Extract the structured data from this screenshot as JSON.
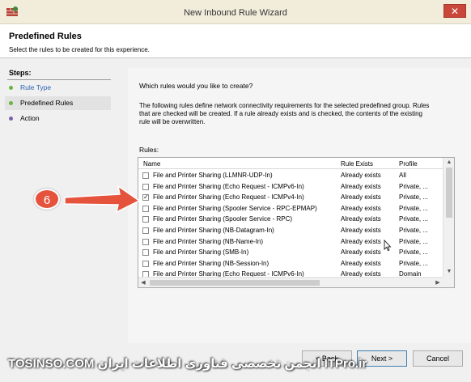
{
  "window": {
    "title": "New Inbound Rule Wizard",
    "close_glyph": "✕",
    "icon": "firewall-icon"
  },
  "header": {
    "title": "Predefined Rules",
    "subtitle": "Select the rules to be created for this experience."
  },
  "steps": {
    "title": "Steps:",
    "items": [
      {
        "label": "Rule Type",
        "color": "#2f64b5"
      },
      {
        "label": "Predefined Rules",
        "color": "#222222"
      },
      {
        "label": "Action",
        "color": "#222222"
      }
    ]
  },
  "content": {
    "question": "Which rules would you like to create?",
    "description": "The following rules define network connectivity requirements for the selected predefined group. Rules that are checked will be created. If a rule already exists and is checked, the contents of the existing rule will be overwritten.",
    "rules_label": "Rules:"
  },
  "table": {
    "columns": [
      "Name",
      "Rule Exists",
      "Profile"
    ],
    "rows": [
      {
        "name": "File and Printer Sharing (LLMNR-UDP-In)",
        "exists": "Already exists",
        "profile": "All",
        "checked": false
      },
      {
        "name": "File and Printer Sharing (Echo Request - ICMPv6-In)",
        "exists": "Already exists",
        "profile": "Private, ...",
        "checked": false
      },
      {
        "name": "File and Printer Sharing (Echo Request - ICMPv4-In)",
        "exists": "Already exists",
        "profile": "Private, ...",
        "checked": true
      },
      {
        "name": "File and Printer Sharing (Spooler Service - RPC-EPMAP)",
        "exists": "Already exists",
        "profile": "Private, ...",
        "checked": false
      },
      {
        "name": "File and Printer Sharing (Spooler Service - RPC)",
        "exists": "Already exists",
        "profile": "Private, ...",
        "checked": false
      },
      {
        "name": "File and Printer Sharing (NB-Datagram-In)",
        "exists": "Already exists",
        "profile": "Private, ...",
        "checked": false
      },
      {
        "name": "File and Printer Sharing (NB-Name-In)",
        "exists": "Already exists",
        "profile": "Private, ...",
        "checked": false
      },
      {
        "name": "File and Printer Sharing (SMB-In)",
        "exists": "Already exists",
        "profile": "Private, ...",
        "checked": false
      },
      {
        "name": "File and Printer Sharing (NB-Session-In)",
        "exists": "Already exists",
        "profile": "Private, ...",
        "checked": false
      },
      {
        "name": "File and Printer Sharing (Echo Request - ICMPv6-In)",
        "exists": "Already exists",
        "profile": "Domain",
        "checked": false
      }
    ]
  },
  "annotation": {
    "number": "6",
    "color": "#e5533d"
  },
  "buttons": {
    "back": "< Back",
    "next": "Next >",
    "cancel": "Cancel"
  },
  "watermark": {
    "text": "TOSINSO.COM انجمن تخصصی فناوری اطلاعات ایران ITPro.ir"
  }
}
